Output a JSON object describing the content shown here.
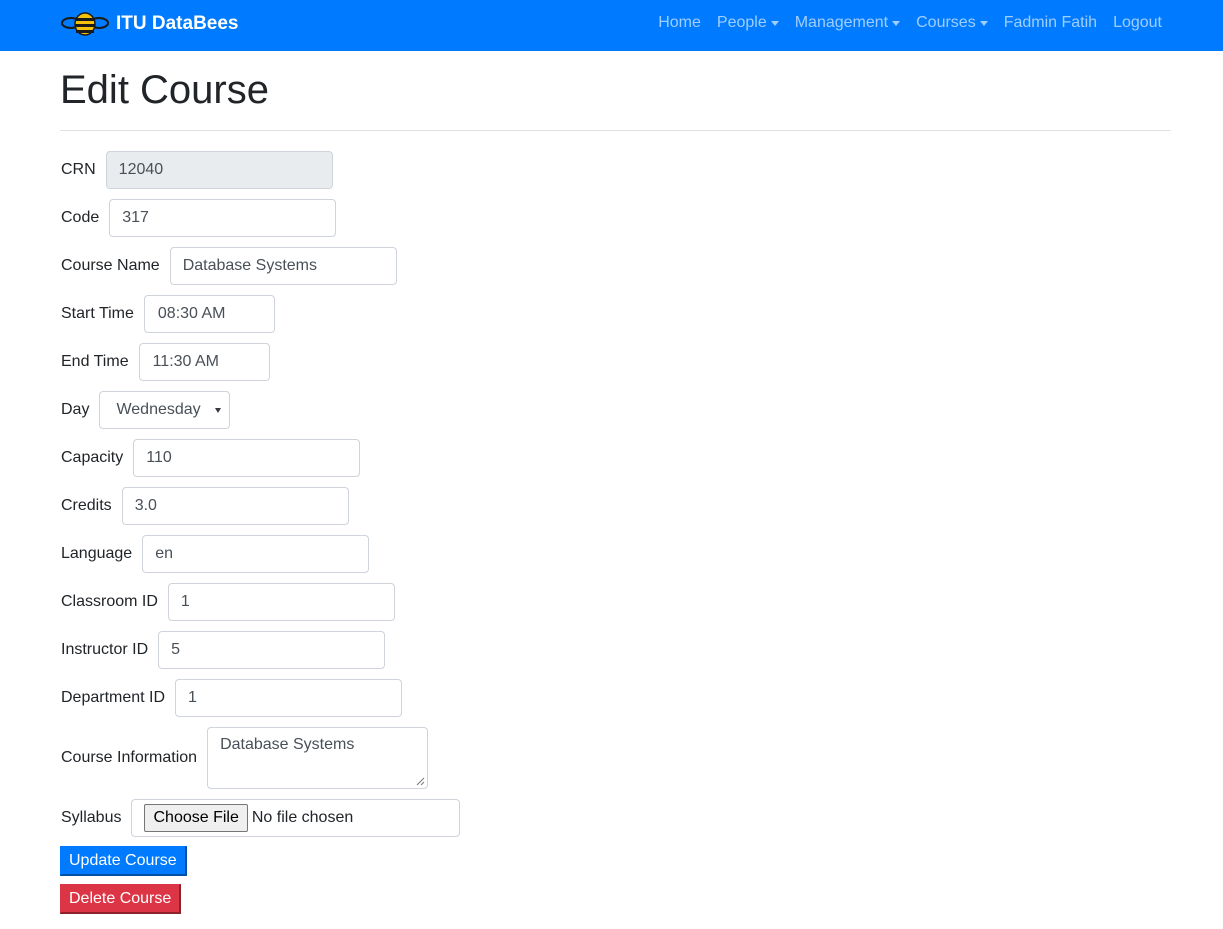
{
  "navbar": {
    "brand": "ITU DataBees",
    "links": [
      {
        "label": "Home",
        "dropdown": false
      },
      {
        "label": "People",
        "dropdown": true
      },
      {
        "label": "Management",
        "dropdown": true
      },
      {
        "label": "Courses",
        "dropdown": true
      },
      {
        "label": "Fadmin Fatih",
        "dropdown": false
      },
      {
        "label": "Logout",
        "dropdown": false
      }
    ],
    "colors": {
      "background": "#007bff"
    }
  },
  "page": {
    "title": "Edit Course"
  },
  "form": {
    "crn": {
      "label": "CRN",
      "value": "12040"
    },
    "code": {
      "label": "Code",
      "value": "317"
    },
    "course_name": {
      "label": "Course Name",
      "value": "Database Systems"
    },
    "start_time": {
      "label": "Start Time",
      "value": "08:30  AM"
    },
    "end_time": {
      "label": "End Time",
      "value": "11:30  AM"
    },
    "day": {
      "label": "Day",
      "value": "Wednesday"
    },
    "capacity": {
      "label": "Capacity",
      "value": "110"
    },
    "credits": {
      "label": "Credits",
      "value": "3.0"
    },
    "language": {
      "label": "Language",
      "value": "en"
    },
    "classroom_id": {
      "label": "Classroom ID",
      "value": "1"
    },
    "instructor_id": {
      "label": "Instructor ID",
      "value": "5"
    },
    "department_id": {
      "label": "Department ID",
      "value": "1"
    },
    "course_information": {
      "label": "Course Information",
      "value": "Database Systems"
    },
    "syllabus": {
      "label": "Syllabus",
      "button": "Choose File",
      "status": "No file chosen"
    }
  },
  "actions": {
    "update": "Update Course",
    "delete": "Delete Course",
    "colors": {
      "primary": "#007bff",
      "danger": "#dc3545"
    }
  }
}
